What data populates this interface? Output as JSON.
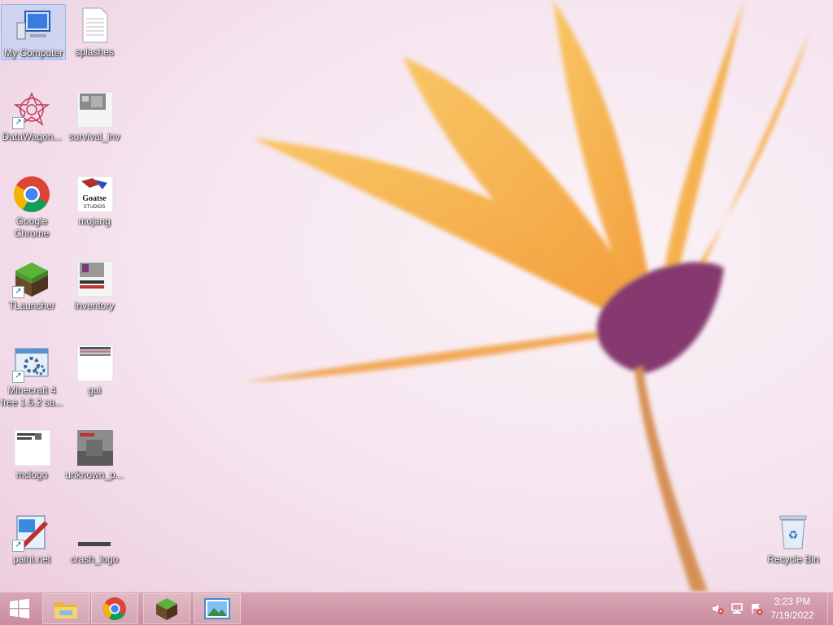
{
  "desktop": {
    "icons": [
      {
        "label": "My Computer"
      },
      {
        "label": "splashes"
      },
      {
        "label": "DataWagon..."
      },
      {
        "label": "survival_inv"
      },
      {
        "label": "Google Chrome"
      },
      {
        "label": "mojang"
      },
      {
        "label": "TLauncher"
      },
      {
        "label": "inventory"
      },
      {
        "label": "Minecraft 4 free 1.5.2 sa..."
      },
      {
        "label": "gui"
      },
      {
        "label": "mclogo"
      },
      {
        "label": "unknown_p..."
      },
      {
        "label": "paint.net"
      },
      {
        "label": "crash_logo"
      },
      {
        "label": "Recycle Bin"
      }
    ]
  },
  "taskbar": {
    "start_icon": "windows-logo-icon",
    "pinned": [
      "file-explorer-icon",
      "chrome-icon",
      "minecraft-icon",
      "photos-icon"
    ],
    "tray": [
      "volume-muted-icon",
      "network-icon",
      "action-center-icon"
    ],
    "clock": {
      "time": "3:23 PM",
      "date": "7/19/2022"
    }
  },
  "colors": {
    "taskbar": "#d9a6b4",
    "accent": "#f4a62a"
  }
}
